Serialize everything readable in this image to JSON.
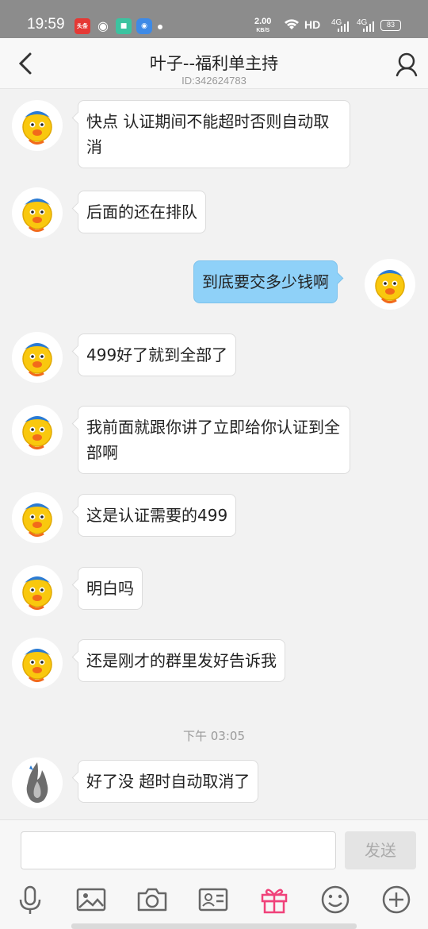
{
  "status_bar": {
    "time": "19:59",
    "speed_value": "2.00",
    "speed_unit": "KB/S",
    "hd": "HD",
    "sig1": "4G",
    "sig2": "4G",
    "battery": "83",
    "toutiao": "头条"
  },
  "header": {
    "title": "叶子--福利单主持",
    "id_line": "ID:342624783"
  },
  "messages": [
    {
      "side": "left",
      "text": "快点 认证期间不能超时否则自动取消"
    },
    {
      "side": "left",
      "text": "后面的还在排队"
    },
    {
      "side": "right",
      "text": "到底要交多少钱啊"
    },
    {
      "side": "left",
      "text": "499好了就到全部了"
    },
    {
      "side": "left",
      "text": "我前面就跟你讲了立即给你认证到全部啊"
    },
    {
      "side": "left",
      "text": "这是认证需要的499"
    },
    {
      "side": "left",
      "text": "明白吗"
    },
    {
      "side": "left",
      "text": "还是刚才的群里发好告诉我"
    },
    {
      "side": "left",
      "text": "好了没 超时自动取消了"
    }
  ],
  "timestamp": "下午 03:05",
  "input": {
    "placeholder": "",
    "send_label": "发送"
  },
  "toolbar": [
    "mic-icon",
    "image-icon",
    "camera-icon",
    "contact-card-icon",
    "gift-icon",
    "emoji-icon",
    "plus-circle-icon"
  ],
  "colors": {
    "accent_gift": "#f0427a",
    "bubble_self": "#8fd1f8",
    "background": "#f2f2f2"
  }
}
